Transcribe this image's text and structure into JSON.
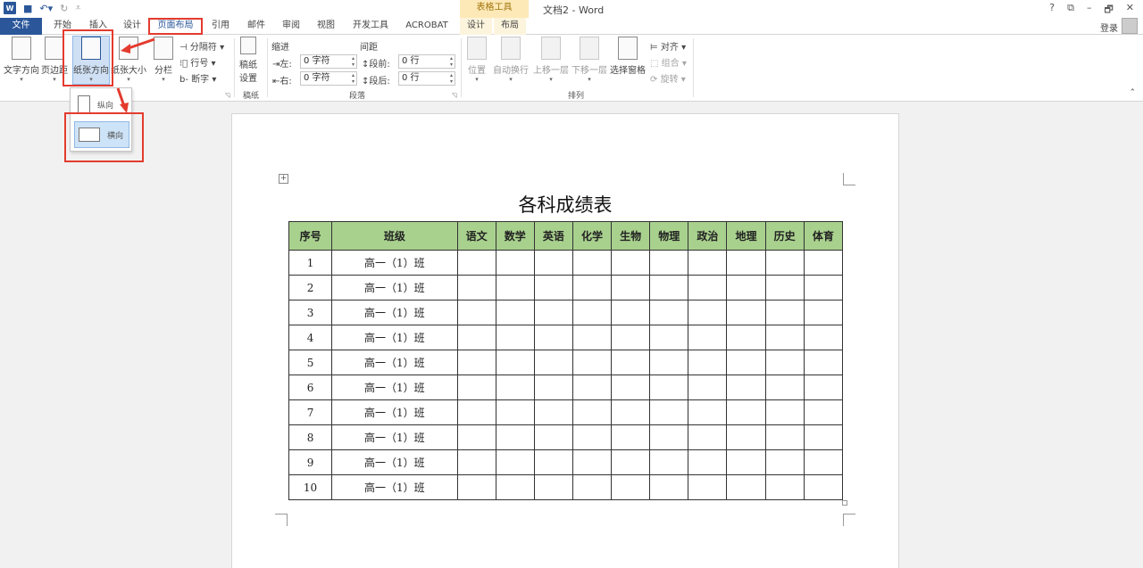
{
  "titlebar": {
    "logo": "W",
    "context_group": "表格工具",
    "doc_title": "文档2 - Word",
    "controls": [
      "?",
      "⧉",
      "–",
      "🗗",
      "✕"
    ]
  },
  "tabs": [
    {
      "label": "文件"
    },
    {
      "label": "开始"
    },
    {
      "label": "插入"
    },
    {
      "label": "设计"
    },
    {
      "label": "页面布局"
    },
    {
      "label": "引用"
    },
    {
      "label": "邮件"
    },
    {
      "label": "审阅"
    },
    {
      "label": "视图"
    },
    {
      "label": "开发工具"
    },
    {
      "label": "ACROBAT"
    },
    {
      "label": "设计"
    },
    {
      "label": "布局"
    }
  ],
  "account": {
    "login": "登录"
  },
  "ribbon": {
    "page_setup": {
      "text_direction": "文字方向",
      "margins": "页边距",
      "orientation": "纸张方向",
      "size": "纸张大小",
      "columns": "分栏",
      "breaks": "分隔符",
      "line_numbers": "行号",
      "hyphenation": "断字"
    },
    "manuscript": {
      "button": "稿纸\n设置",
      "group": "稿纸"
    },
    "paragraph": {
      "indent_label": "缩进",
      "spacing_label": "间距",
      "left_label": "左:",
      "left_value": "0 字符",
      "right_label": "右:",
      "right_value": "0 字符",
      "before_label": "段前:",
      "before_value": "0 行",
      "after_label": "段后:",
      "after_value": "0 行",
      "group": "段落"
    },
    "arrange": {
      "position": "位置",
      "wrap_text": "自动换行",
      "bring_forward": "上移一层",
      "send_backward": "下移一层",
      "selection_pane": "选择窗格",
      "align": "对齐",
      "group_btn": "组合",
      "rotate": "旋转",
      "group": "排列"
    }
  },
  "orientation_menu": {
    "portrait": "纵向",
    "landscape": "横向"
  },
  "document": {
    "title": "各科成绩表",
    "headers": [
      "序号",
      "班级",
      "语文",
      "数学",
      "英语",
      "化学",
      "生物",
      "物理",
      "政治",
      "地理",
      "历史",
      "体育"
    ],
    "rows": [
      [
        "1",
        "高一（1）班"
      ],
      [
        "2",
        "高一（1）班"
      ],
      [
        "3",
        "高一（1）班"
      ],
      [
        "4",
        "高一（1）班"
      ],
      [
        "5",
        "高一（1）班"
      ],
      [
        "6",
        "高一（1）班"
      ],
      [
        "7",
        "高一（1）班"
      ],
      [
        "8",
        "高一（1）班"
      ],
      [
        "9",
        "高一（1）班"
      ],
      [
        "10",
        "高一（1）班"
      ]
    ]
  },
  "colors": {
    "word_blue": "#2b579a",
    "highlight_red": "#e33b2e",
    "table_header": "#a9d18e",
    "context_tab": "#fde9b7"
  }
}
